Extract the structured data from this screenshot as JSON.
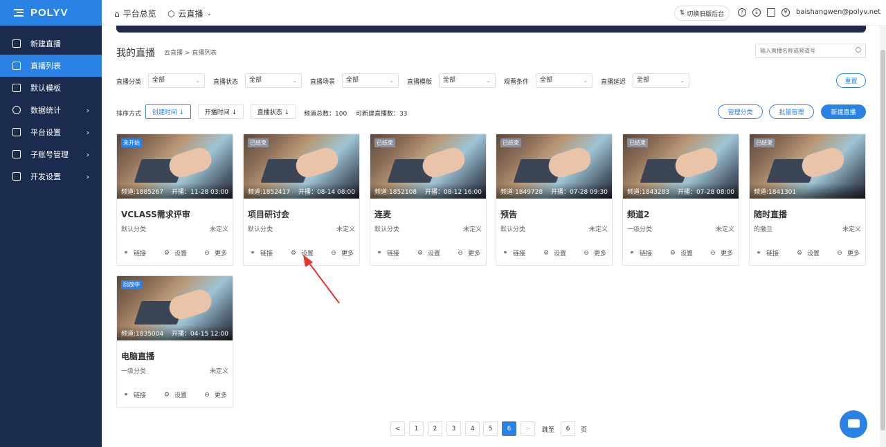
{
  "sidebar": {
    "logo": "POLYV",
    "items": [
      {
        "label": "新建直播",
        "icon": "video-icon",
        "active": false,
        "arrow": false
      },
      {
        "label": "直播列表",
        "icon": "list-icon",
        "active": true,
        "arrow": false
      },
      {
        "label": "默认模板",
        "icon": "template-icon",
        "active": false,
        "arrow": false
      },
      {
        "label": "数据统计",
        "icon": "chart-icon",
        "active": false,
        "arrow": true
      },
      {
        "label": "平台设置",
        "icon": "layers-icon",
        "active": false,
        "arrow": true
      },
      {
        "label": "子账号管理",
        "icon": "id-card-icon",
        "active": false,
        "arrow": true
      },
      {
        "label": "开发设置",
        "icon": "code-icon",
        "active": false,
        "arrow": true
      }
    ]
  },
  "header": {
    "home": "平台总览",
    "product": "云直播",
    "switch_label": "切换旧版后台",
    "user": "baishangwen@polyv.net"
  },
  "main": {
    "title": "我的直播",
    "breadcrumb": "云直播 > 直播列表",
    "search_placeholder": "输入直播名称或频道号",
    "filters": [
      {
        "label": "直播分类",
        "value": "全部"
      },
      {
        "label": "直播状态",
        "value": "全部"
      },
      {
        "label": "直播场景",
        "value": "全部"
      },
      {
        "label": "直播模版",
        "value": "全部"
      },
      {
        "label": "观看条件",
        "value": "全部"
      },
      {
        "label": "直播延迟",
        "value": "全部"
      }
    ],
    "reset_label": "重置",
    "sort_label": "排序方式",
    "sort_buttons": [
      "创建时间 ↓",
      "开播时间 ↓",
      "直播状态 ↓"
    ],
    "stats": {
      "total": "频道总数：100",
      "remaining": "可新建直播数：33"
    },
    "manage_category": "管理分类",
    "batch_manage": "批量管理",
    "new_live": "新建直播",
    "cards": [
      {
        "status": "未开始",
        "status_color": "#2a82e4",
        "channel": "频道:1885267",
        "start": "开播：11-28 03:00",
        "title": "VCLASS需求评审",
        "category": "默认分类",
        "extra": "未定义"
      },
      {
        "status": "已结束",
        "status_color": "#8c8f96",
        "channel": "频道:1852417",
        "start": "开播：08-14 08:00",
        "title": "项目研讨会",
        "category": "默认分类",
        "extra": "未定义"
      },
      {
        "status": "已结束",
        "status_color": "#8c8f96",
        "channel": "频道:1852108",
        "start": "开播：08-12 16:00",
        "title": "连麦",
        "category": "默认分类",
        "extra": "未定义"
      },
      {
        "status": "已结束",
        "status_color": "#8c8f96",
        "channel": "频道:1849728",
        "start": "开播：07-28 09:30",
        "title": "预告",
        "category": "默认分类",
        "extra": "未定义"
      },
      {
        "status": "已结束",
        "status_color": "#8c8f96",
        "channel": "频道:1843283",
        "start": "开播：07-28 08:00",
        "title": "频道2",
        "category": "一级分类",
        "extra": "未定义"
      },
      {
        "status": "已结束",
        "status_color": "#8c8f96",
        "channel": "频道:1841301",
        "start": "",
        "title": "随时直播",
        "category": "的撒旦",
        "extra": "未定义"
      },
      {
        "status": "回放中",
        "status_color": "#2a82e4",
        "channel": "频道:1835004",
        "start": "开播：04-15 12:00",
        "title": "电脑直播",
        "category": "一级分类",
        "extra": "未定义"
      }
    ],
    "card_actions": {
      "link": "链接",
      "settings": "设置",
      "more": "更多"
    }
  },
  "pagination": {
    "prev": "<",
    "pages": [
      "1",
      "2",
      "3",
      "4",
      "5",
      "6"
    ],
    "current": "6",
    "next": ">",
    "jump_label": "跳至",
    "jump_value": "6",
    "page_suffix": "页"
  }
}
